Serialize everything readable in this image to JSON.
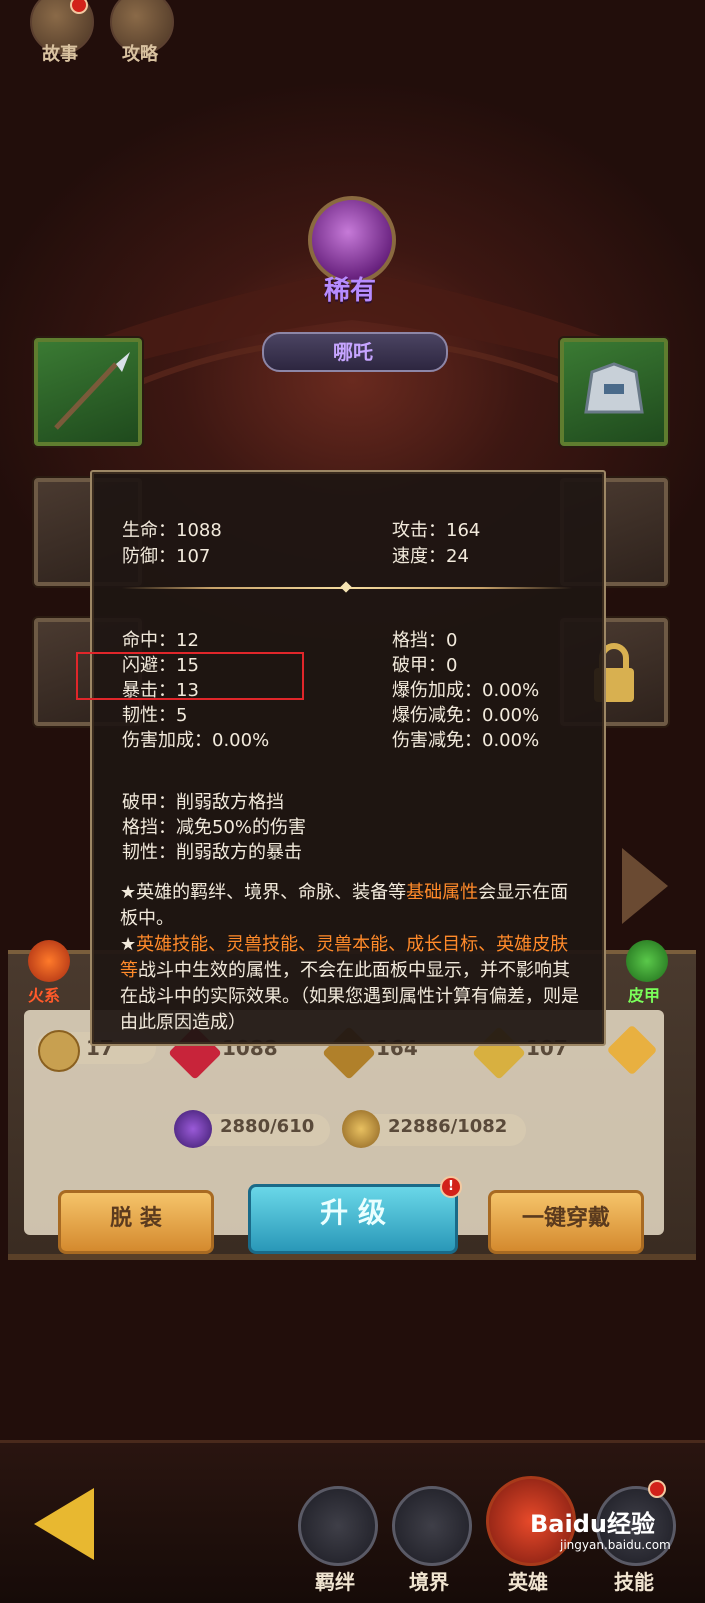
{
  "top": {
    "story_label": "故事",
    "guide_label": "攻略"
  },
  "hero": {
    "rarity": "稀有",
    "name": "哪吒"
  },
  "stats_panel": {
    "base": [
      {
        "left": "生命：1088",
        "right": "攻击：164"
      },
      {
        "left": "防御：107",
        "right": "速度：24"
      }
    ],
    "extra": [
      {
        "left": "命中：12",
        "right": "格挡：0"
      },
      {
        "left": "闪避：15",
        "right": "破甲：0"
      },
      {
        "left": "暴击：13",
        "right": "爆伤加成：0.00%"
      },
      {
        "left": "韧性：5",
        "right": "爆伤减免：0.00%"
      },
      {
        "left": "伤害加成：0.00%",
        "right": "伤害减免：0.00%"
      }
    ],
    "explain": [
      "破甲：削弱敌方格挡",
      "格挡：减免50%的伤害",
      "韧性：削弱敌方的暴击"
    ],
    "note1_a": "★英雄的羁绊、境界、命脉、装备等",
    "note1_b": "基础属性",
    "note1_c": "会显示在面板中。",
    "note2_a": "★",
    "note2_b": "英雄技能、灵兽技能、灵兽本能、成长目标、英雄皮肤等",
    "note2_c": "战斗中生效的属性，不会在此面板中显示，并不影响其在战斗中的实际效果。（如果您遇到属性计算有偏差，则是由此原因造成）"
  },
  "side": {
    "left_element": "火系",
    "right_element": "皮甲"
  },
  "lower": {
    "level": "17",
    "hp": "1088",
    "atk": "164",
    "def": "107",
    "res1": "2880/610",
    "res2": "22886/1082",
    "unequip": "脱 装",
    "upgrade": "升 级",
    "equip_all": "一键穿戴",
    "badge": "!"
  },
  "nav": {
    "bond": "羁绊",
    "realm": "境界",
    "hero": "英雄",
    "skill": "技能"
  },
  "watermark": {
    "brand": "Baidu经验",
    "url": "jingyan.baidu.com"
  },
  "colors": {
    "highlight": "#e0262a",
    "accent_orange": "#ff8a2a",
    "rarity_purple": "#b78cff"
  }
}
